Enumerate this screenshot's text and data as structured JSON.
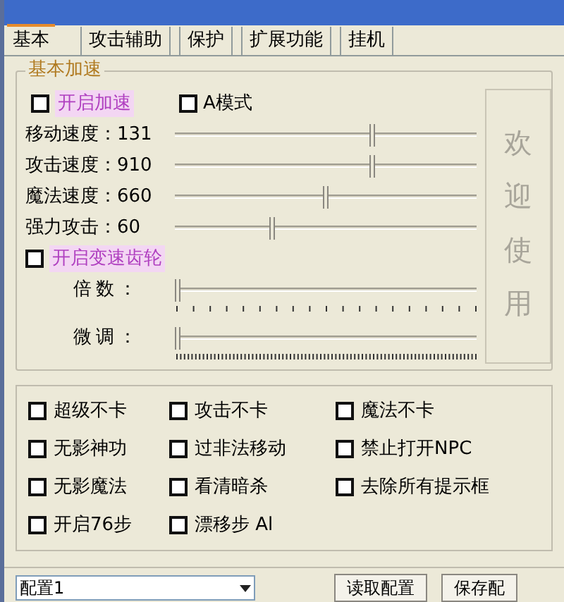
{
  "tabs": [
    {
      "label": "基本",
      "selected": true
    },
    {
      "label": "攻击辅助",
      "selected": false
    },
    {
      "label": "保护",
      "selected": false
    },
    {
      "label": "扩展功能",
      "selected": false
    },
    {
      "label": "挂机",
      "selected": false
    }
  ],
  "group": {
    "title": "基本加速",
    "top_options": [
      {
        "label": "开启加速",
        "checked": false,
        "kind": "highlight"
      },
      {
        "label": "A模式",
        "checked": false,
        "kind": "plain"
      }
    ],
    "speed_sliders": [
      {
        "label": "移动速度：131",
        "level": 0.66
      },
      {
        "label": "攻击速度：910",
        "level": 0.66
      },
      {
        "label": "魔法速度：660",
        "level": 0.5
      },
      {
        "label": "强力攻击：60",
        "level": 0.32
      }
    ],
    "gear_option": {
      "label": "开启变速齿轮",
      "checked": false
    },
    "gear_sliders": [
      {
        "label": "倍数：",
        "level": 0,
        "kind": "coarse"
      },
      {
        "label": "微调：",
        "level": 0,
        "kind": "fine"
      }
    ],
    "welcome": "欢迎使用"
  },
  "options": [
    {
      "label": "超级不卡",
      "checked": false
    },
    {
      "label": "攻击不卡",
      "checked": false
    },
    {
      "label": "魔法不卡",
      "checked": false
    },
    {
      "label": "无影神功",
      "checked": false
    },
    {
      "label": "过非法移动",
      "checked": false
    },
    {
      "label": "禁止打开NPC",
      "checked": false
    },
    {
      "label": "无影魔法",
      "checked": false
    },
    {
      "label": "看清暗杀",
      "checked": false
    },
    {
      "label": "去除所有提示框",
      "checked": false
    },
    {
      "label": "开启76步",
      "checked": false
    },
    {
      "label": "漂移步 Al",
      "checked": false
    }
  ],
  "config": {
    "value": "配置1",
    "buttons": [
      "读取配置",
      "保存配"
    ]
  }
}
